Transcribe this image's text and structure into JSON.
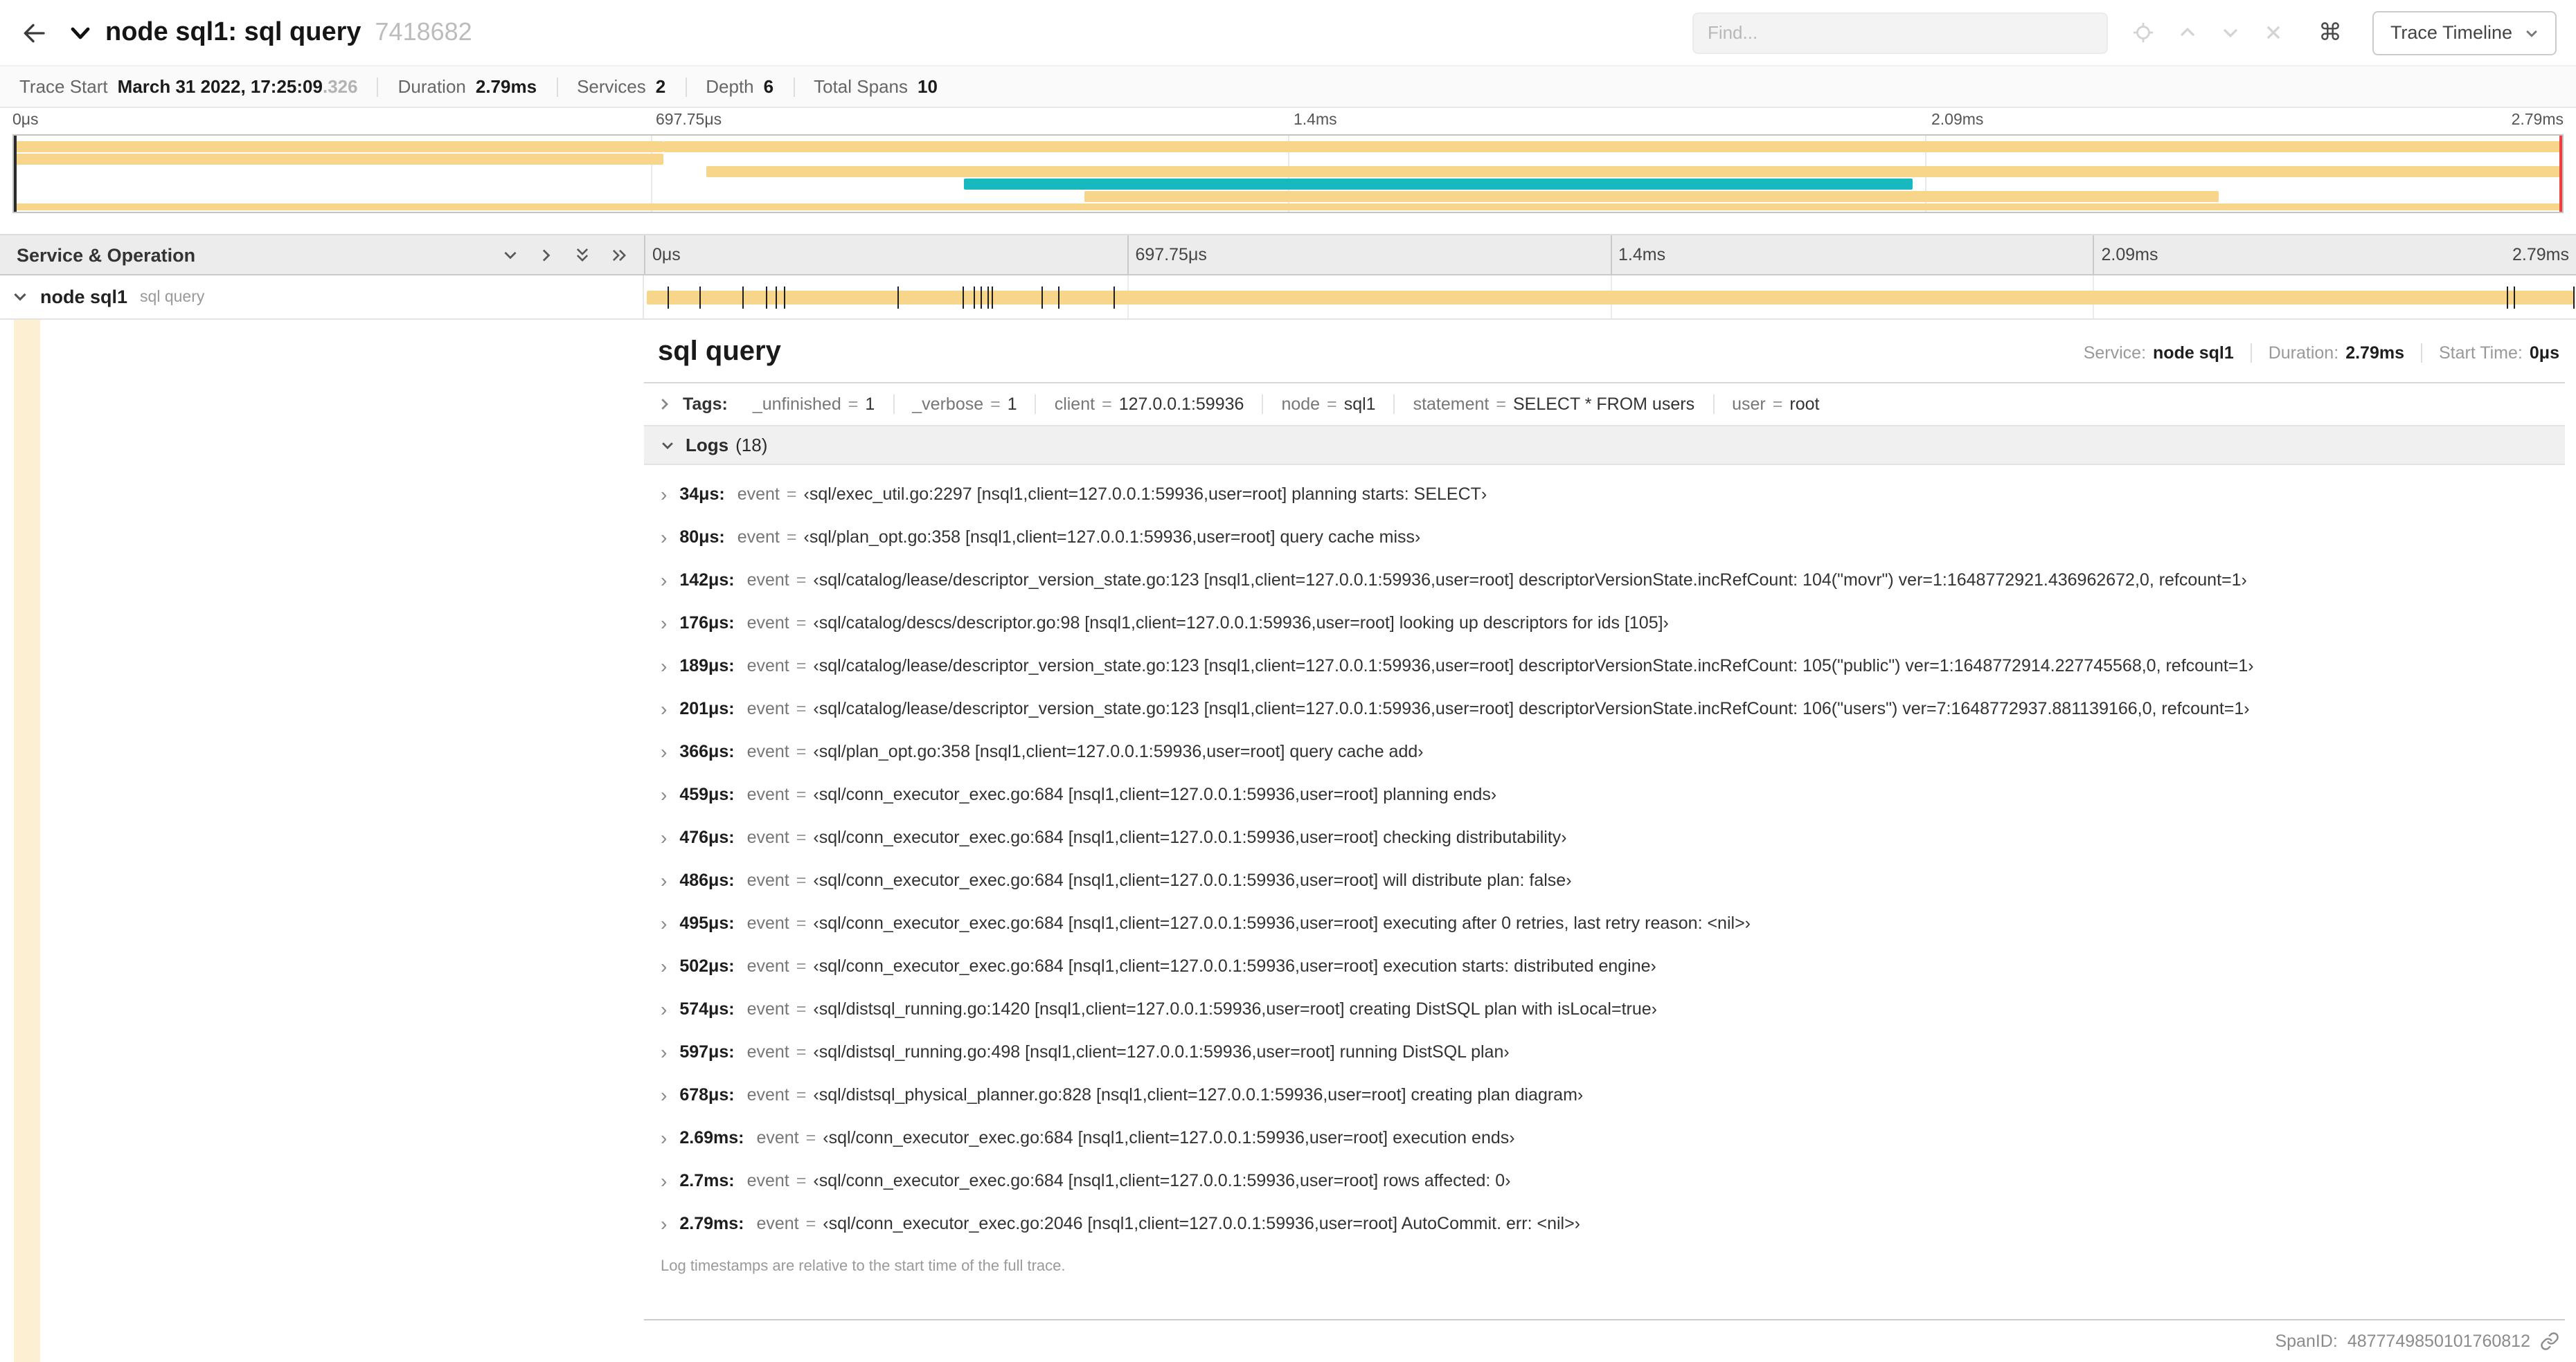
{
  "header": {
    "title": "node sql1: sql query",
    "trace_id": "7418682",
    "find_placeholder": "Find...",
    "trace_timeline_label": "Trace Timeline"
  },
  "icons": {
    "command_glyph": "⌘",
    "expand_glyph": "›",
    "equals_sign": "="
  },
  "summary": [
    {
      "label": "Trace Start",
      "value": "March 31 2022, 17:25:09",
      "suffix": ".326"
    },
    {
      "label": "Duration",
      "value": "2.79ms"
    },
    {
      "label": "Services",
      "value": "2"
    },
    {
      "label": "Depth",
      "value": "6"
    },
    {
      "label": "Total Spans",
      "value": "10"
    }
  ],
  "timeline": {
    "ticks": [
      "0μs",
      "697.75μs",
      "1.4ms",
      "2.09ms",
      "2.79ms"
    ],
    "duration_us": 2790,
    "colors": {
      "span": "#F7D58A",
      "accent": "#17B8BE",
      "scrubber": "#F03E3E"
    },
    "minimap_bars": [
      {
        "row": 0,
        "left": 0,
        "width": 25.5,
        "color": "#F7D58A"
      },
      {
        "row": 0,
        "left": 25.5,
        "width": 74.5,
        "color": "#F7D58A"
      },
      {
        "row": 1,
        "left": 0,
        "width": 25.5,
        "color": "#F7D58A"
      },
      {
        "row": 2,
        "left": 27.2,
        "width": 72.8,
        "color": "#F7D58A"
      },
      {
        "row": 3,
        "left": 37.3,
        "width": 37.2,
        "color": "#17B8BE"
      },
      {
        "row": 4,
        "left": 42.0,
        "width": 44.5,
        "color": "#F7D58A"
      },
      {
        "row": 5,
        "left": 0,
        "width": 100,
        "color": "#F7D58A"
      }
    ]
  },
  "tree": {
    "header_label": "Service & Operation",
    "row": {
      "service": "node sql1",
      "operation": "sql query"
    }
  },
  "detail": {
    "title": "sql query",
    "meta": [
      {
        "label": "Service:",
        "value": "node sql1"
      },
      {
        "label": "Duration:",
        "value": "2.79ms"
      },
      {
        "label": "Start Time:",
        "value": "0μs"
      }
    ],
    "tags_label": "Tags:",
    "tags": [
      {
        "key": "_unfinished",
        "value": "1"
      },
      {
        "key": "_verbose",
        "value": "1"
      },
      {
        "key": "client",
        "value": "127.0.0.1:59936"
      },
      {
        "key": "node",
        "value": "sql1"
      },
      {
        "key": "statement",
        "value": "SELECT * FROM users"
      },
      {
        "key": "user",
        "value": "root"
      }
    ],
    "logs_label": "Logs",
    "logs_count": "(18)",
    "logs": [
      {
        "t_us": 34,
        "time": "34μs:",
        "key": "event",
        "value": "‹sql/exec_util.go:2297 [nsql1,client=127.0.0.1:59936,user=root] planning starts: SELECT›"
      },
      {
        "t_us": 80,
        "time": "80μs:",
        "key": "event",
        "value": "‹sql/plan_opt.go:358 [nsql1,client=127.0.0.1:59936,user=root] query cache miss›"
      },
      {
        "t_us": 142,
        "time": "142μs:",
        "key": "event",
        "value": "‹sql/catalog/lease/descriptor_version_state.go:123 [nsql1,client=127.0.0.1:59936,user=root] descriptorVersionState.incRefCount: 104(\"movr\") ver=1:1648772921.436962672,0, refcount=1›"
      },
      {
        "t_us": 176,
        "time": "176μs:",
        "key": "event",
        "value": "‹sql/catalog/descs/descriptor.go:98 [nsql1,client=127.0.0.1:59936,user=root] looking up descriptors for ids [105]›"
      },
      {
        "t_us": 189,
        "time": "189μs:",
        "key": "event",
        "value": "‹sql/catalog/lease/descriptor_version_state.go:123 [nsql1,client=127.0.0.1:59936,user=root] descriptorVersionState.incRefCount: 105(\"public\") ver=1:1648772914.227745568,0, refcount=1›"
      },
      {
        "t_us": 201,
        "time": "201μs:",
        "key": "event",
        "value": "‹sql/catalog/lease/descriptor_version_state.go:123 [nsql1,client=127.0.0.1:59936,user=root] descriptorVersionState.incRefCount: 106(\"users\") ver=7:1648772937.881139166,0, refcount=1›"
      },
      {
        "t_us": 366,
        "time": "366μs:",
        "key": "event",
        "value": "‹sql/plan_opt.go:358 [nsql1,client=127.0.0.1:59936,user=root] query cache add›"
      },
      {
        "t_us": 459,
        "time": "459μs:",
        "key": "event",
        "value": "‹sql/conn_executor_exec.go:684 [nsql1,client=127.0.0.1:59936,user=root] planning ends›"
      },
      {
        "t_us": 476,
        "time": "476μs:",
        "key": "event",
        "value": "‹sql/conn_executor_exec.go:684 [nsql1,client=127.0.0.1:59936,user=root] checking distributability›"
      },
      {
        "t_us": 486,
        "time": "486μs:",
        "key": "event",
        "value": "‹sql/conn_executor_exec.go:684 [nsql1,client=127.0.0.1:59936,user=root] will distribute plan: false›"
      },
      {
        "t_us": 495,
        "time": "495μs:",
        "key": "event",
        "value": "‹sql/conn_executor_exec.go:684 [nsql1,client=127.0.0.1:59936,user=root] executing after 0 retries, last retry reason: <nil>›"
      },
      {
        "t_us": 502,
        "time": "502μs:",
        "key": "event",
        "value": "‹sql/conn_executor_exec.go:684 [nsql1,client=127.0.0.1:59936,user=root] execution starts: distributed engine›"
      },
      {
        "t_us": 574,
        "time": "574μs:",
        "key": "event",
        "value": "‹sql/distsql_running.go:1420 [nsql1,client=127.0.0.1:59936,user=root] creating DistSQL plan with isLocal=true›"
      },
      {
        "t_us": 597,
        "time": "597μs:",
        "key": "event",
        "value": "‹sql/distsql_running.go:498 [nsql1,client=127.0.0.1:59936,user=root] running DistSQL plan›"
      },
      {
        "t_us": 678,
        "time": "678μs:",
        "key": "event",
        "value": "‹sql/distsql_physical_planner.go:828 [nsql1,client=127.0.0.1:59936,user=root] creating plan diagram›"
      },
      {
        "t_us": 2690,
        "time": "2.69ms:",
        "key": "event",
        "value": "‹sql/conn_executor_exec.go:684 [nsql1,client=127.0.0.1:59936,user=root] execution ends›"
      },
      {
        "t_us": 2700,
        "time": "2.7ms:",
        "key": "event",
        "value": "‹sql/conn_executor_exec.go:684 [nsql1,client=127.0.0.1:59936,user=root] rows affected: 0›"
      },
      {
        "t_us": 2790,
        "time": "2.79ms:",
        "key": "event",
        "value": "‹sql/conn_executor_exec.go:2046 [nsql1,client=127.0.0.1:59936,user=root] AutoCommit. err: <nil>›"
      }
    ],
    "logs_footnote": "Log timestamps are relative to the start time of the full trace.",
    "span_id_label": "SpanID:",
    "span_id": "4877749850101760812"
  }
}
